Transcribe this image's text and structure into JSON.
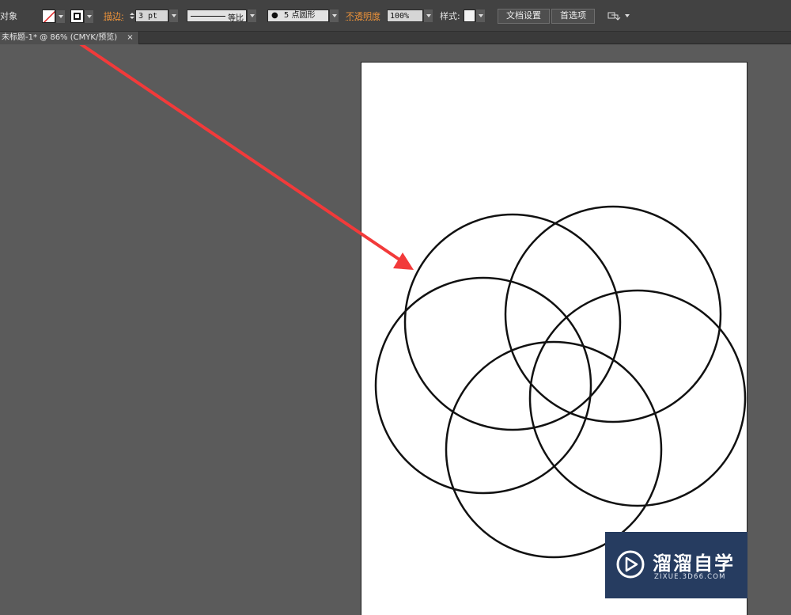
{
  "control_bar": {
    "object_label": "对象",
    "stroke_label": "描边:",
    "stroke_weight": "3 pt",
    "profile_label": "等比",
    "brush_label": "5 点圆形",
    "opacity_label": "不透明度",
    "opacity_value": "100%",
    "style_label": "样式:",
    "doc_setup_button": "文档设置",
    "preferences_button": "首选项"
  },
  "tab_bar": {
    "tab_title": "未标题-1* @ 86% (CMYK/预览)",
    "close_glyph": "×"
  },
  "colors": {
    "panel": "#424242",
    "canvas": "#5b5b5b",
    "artboard": "#ffffff",
    "accent_orange": "#e9913a",
    "arrow": "#f23a3a",
    "watermark_bg": "#263c60"
  },
  "watermark": {
    "title": "溜溜自学",
    "subtitle": "ZIXUE.3D66.COM"
  }
}
